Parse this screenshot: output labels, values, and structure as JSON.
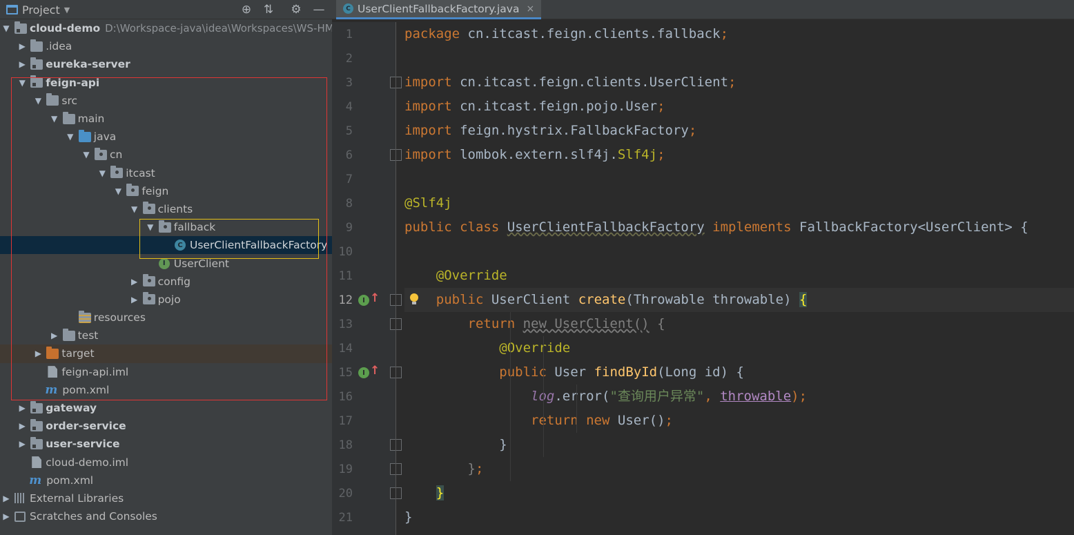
{
  "panel": {
    "title": "Project",
    "dropdown_icon": "▼",
    "toolbar_icons": [
      "locate-icon",
      "collapse-icon",
      "gear-icon",
      "hide-icon"
    ]
  },
  "tree": [
    {
      "label": "cloud-demo",
      "path": "D:\\Workspace-java\\idea\\Workspaces\\WS-HM-",
      "indent": 0,
      "arrow": "▼",
      "icon": "module",
      "bold": true
    },
    {
      "label": ".idea",
      "indent": 1,
      "arrow": "▶",
      "icon": "folder"
    },
    {
      "label": "eureka-server",
      "indent": 1,
      "arrow": "▶",
      "icon": "module",
      "bold": true
    },
    {
      "label": "feign-api",
      "indent": 1,
      "arrow": "▼",
      "icon": "module",
      "bold": true
    },
    {
      "label": "src",
      "indent": 2,
      "arrow": "▼",
      "icon": "folder"
    },
    {
      "label": "main",
      "indent": 3,
      "arrow": "▼",
      "icon": "folder"
    },
    {
      "label": "java",
      "indent": 4,
      "arrow": "▼",
      "icon": "folder-blue"
    },
    {
      "label": "cn",
      "indent": 5,
      "arrow": "▼",
      "icon": "package"
    },
    {
      "label": "itcast",
      "indent": 6,
      "arrow": "▼",
      "icon": "package"
    },
    {
      "label": "feign",
      "indent": 7,
      "arrow": "▼",
      "icon": "package"
    },
    {
      "label": "clients",
      "indent": 8,
      "arrow": "▼",
      "icon": "package"
    },
    {
      "label": "fallback",
      "indent": 9,
      "arrow": "▼",
      "icon": "package"
    },
    {
      "label": "UserClientFallbackFactory",
      "indent": 10,
      "arrow": "",
      "icon": "class",
      "selected": true
    },
    {
      "label": "UserClient",
      "indent": 9,
      "arrow": "",
      "icon": "interface"
    },
    {
      "label": "config",
      "indent": 8,
      "arrow": "▶",
      "icon": "package"
    },
    {
      "label": "pojo",
      "indent": 8,
      "arrow": "▶",
      "icon": "package"
    },
    {
      "label": "resources",
      "indent": 4,
      "arrow": "",
      "icon": "folder-res"
    },
    {
      "label": "test",
      "indent": 3,
      "arrow": "▶",
      "icon": "folder"
    },
    {
      "label": "target",
      "indent": 2,
      "arrow": "▶",
      "icon": "folder-orange",
      "highlight": true
    },
    {
      "label": "feign-api.iml",
      "indent": 2,
      "arrow": "",
      "icon": "file"
    },
    {
      "label": "pom.xml",
      "indent": 2,
      "arrow": "",
      "icon": "maven"
    },
    {
      "label": "gateway",
      "indent": 1,
      "arrow": "▶",
      "icon": "module",
      "bold": true
    },
    {
      "label": "order-service",
      "indent": 1,
      "arrow": "▶",
      "icon": "module",
      "bold": true
    },
    {
      "label": "user-service",
      "indent": 1,
      "arrow": "▶",
      "icon": "module",
      "bold": true
    },
    {
      "label": "cloud-demo.iml",
      "indent": 1,
      "arrow": "",
      "icon": "file"
    },
    {
      "label": "pom.xml",
      "indent": 1,
      "arrow": "",
      "icon": "maven"
    },
    {
      "label": "External Libraries",
      "indent": 0,
      "arrow": "▶",
      "icon": "libs"
    },
    {
      "label": "Scratches and Consoles",
      "indent": 0,
      "arrow": "▶",
      "icon": "scratch"
    }
  ],
  "editor": {
    "tab_label": "UserClientFallbackFactory.java",
    "tab_close": "×",
    "current_line": 12,
    "lines": [
      [
        [
          "kw",
          "package "
        ],
        [
          "",
          "cn.itcast.feign.clients.fallback"
        ],
        [
          "kw",
          ";"
        ]
      ],
      [],
      [
        [
          "kw",
          "import "
        ],
        [
          "",
          "cn.itcast.feign.clients.UserClient"
        ],
        [
          "kw",
          ";"
        ]
      ],
      [
        [
          "kw",
          "import "
        ],
        [
          "",
          "cn.itcast.feign.pojo.User"
        ],
        [
          "kw",
          ";"
        ]
      ],
      [
        [
          "kw",
          "import "
        ],
        [
          "",
          "feign.hystrix.FallbackFactory"
        ],
        [
          "kw",
          ";"
        ]
      ],
      [
        [
          "kw",
          "import "
        ],
        [
          "",
          "lombok.extern.slf4j."
        ],
        [
          "ann",
          "Slf4j"
        ],
        [
          "kw",
          ";"
        ]
      ],
      [],
      [
        [
          "ann",
          "@Slf4j"
        ]
      ],
      [
        [
          "kw",
          "public class "
        ],
        [
          "wavy",
          "UserClientFallbackFactory"
        ],
        [
          "",
          " "
        ],
        [
          "kw",
          "implements "
        ],
        [
          "",
          "FallbackFactory<UserClient> {"
        ]
      ],
      [],
      [
        [
          "",
          "    "
        ],
        [
          "ann",
          "@Override"
        ]
      ],
      [
        [
          "",
          "    "
        ],
        [
          "kw",
          "public "
        ],
        [
          "",
          "UserClient "
        ],
        [
          "fn",
          "create"
        ],
        [
          "",
          "(Throwable throwable) "
        ],
        [
          "brace-hl",
          "{"
        ]
      ],
      [
        [
          "",
          "        "
        ],
        [
          "kw",
          "return "
        ],
        [
          "wavy-g",
          "new UserClient()"
        ],
        [
          "muted",
          " {"
        ]
      ],
      [
        [
          "",
          "            "
        ],
        [
          "ann",
          "@Override"
        ]
      ],
      [
        [
          "",
          "            "
        ],
        [
          "kw",
          "public "
        ],
        [
          "",
          "User "
        ],
        [
          "fn",
          "findById"
        ],
        [
          "",
          "(Long id) {"
        ]
      ],
      [
        [
          "",
          "                "
        ],
        [
          "fld",
          "log"
        ],
        [
          "",
          ".error("
        ],
        [
          "str",
          "\"查询用户异常\""
        ],
        [
          "kw",
          ", "
        ],
        [
          "param",
          "throwable"
        ],
        [
          "kw",
          ");"
        ]
      ],
      [
        [
          "",
          "                "
        ],
        [
          "kw",
          "return new "
        ],
        [
          "",
          "User()"
        ],
        [
          "kw",
          ";"
        ]
      ],
      [
        [
          "",
          "            "
        ],
        [
          "",
          "}"
        ]
      ],
      [
        [
          "",
          "        "
        ],
        [
          "muted",
          "}"
        ],
        [
          "kw",
          ";"
        ]
      ],
      [
        [
          "",
          "    "
        ],
        [
          "brace-hl",
          "}"
        ]
      ],
      [
        [
          "",
          "}"
        ]
      ]
    ]
  }
}
